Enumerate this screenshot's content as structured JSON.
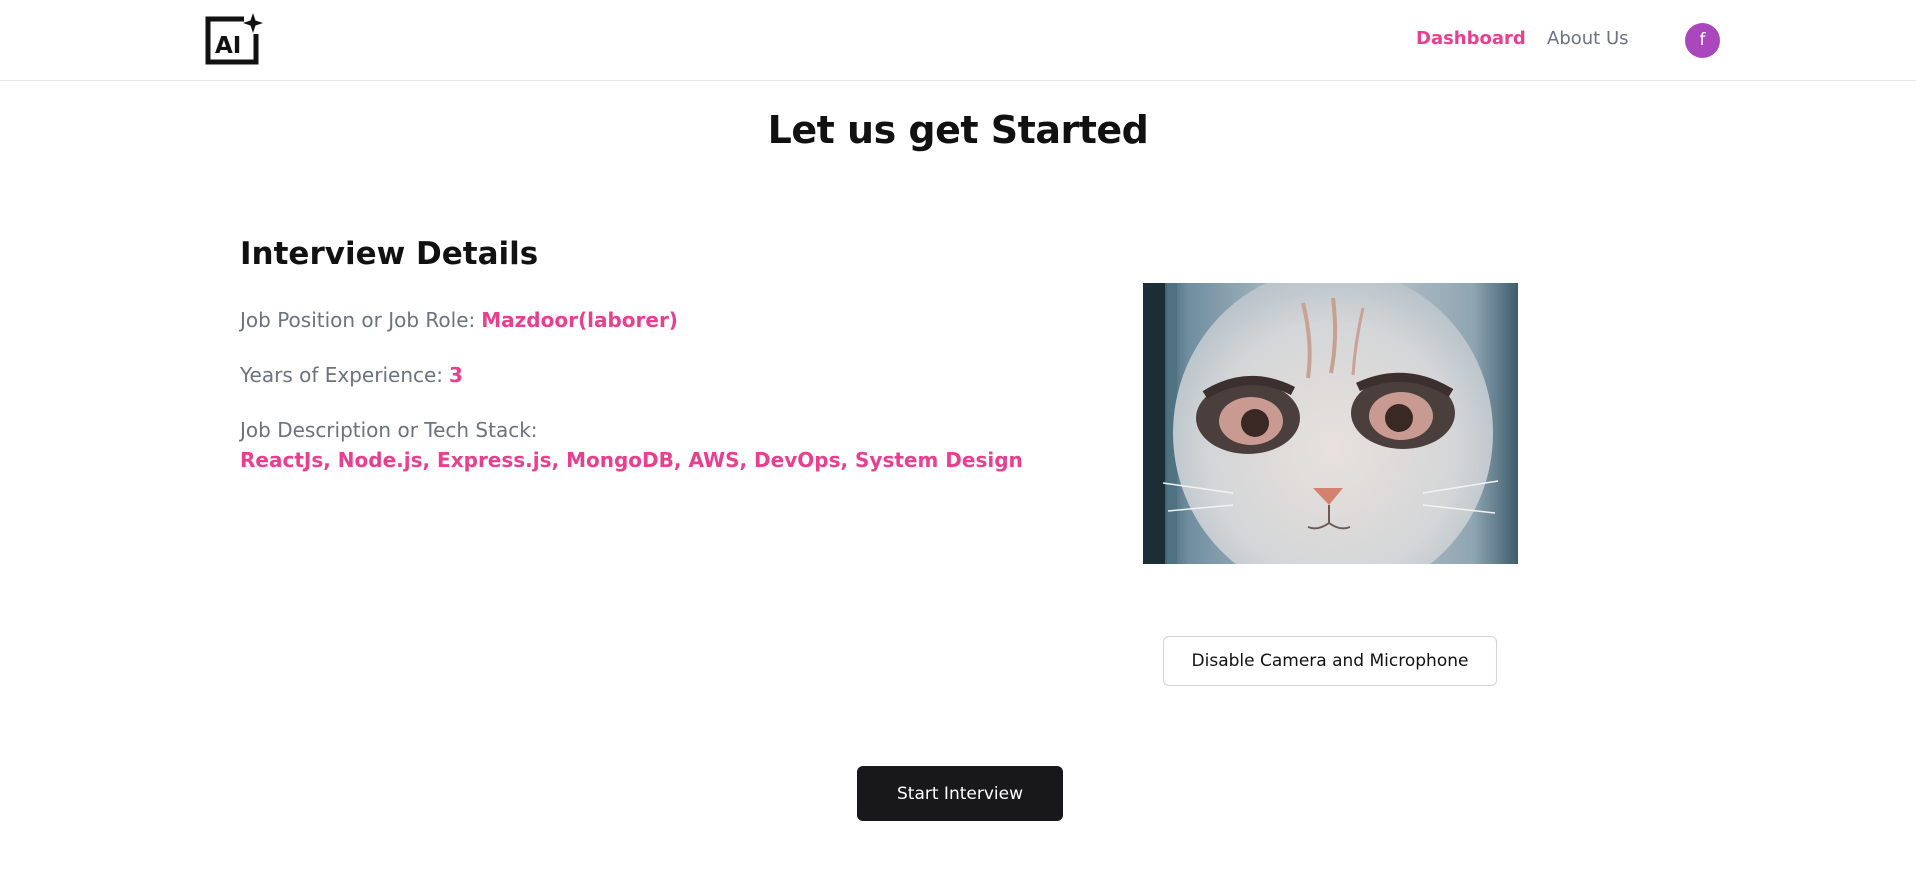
{
  "nav": {
    "logo_text": "AI",
    "links": [
      {
        "label": "Dashboard",
        "active": true
      },
      {
        "label": "About Us",
        "active": false
      }
    ],
    "avatar_initial": "f",
    "avatar_color": "#ab47bc"
  },
  "page": {
    "title": "Let us get Started"
  },
  "details": {
    "heading": "Interview Details",
    "job_role_label": "Job Position or Job Role:",
    "job_role_value": "Mazdoor(laborer)",
    "experience_label": "Years of Experience:",
    "experience_value": "3",
    "description_label": "Job Description or Tech Stack:",
    "description_value": "ReactJs, Node.js, Express.js, MongoDB, AWS, DevOps, System Design"
  },
  "camera": {
    "subject": "webcam-feed-cat-face"
  },
  "buttons": {
    "toggle_media_label": "Disable Camera and Microphone",
    "start_label": "Start Interview"
  },
  "colors": {
    "accent": "#e8408f",
    "muted_text": "#6b7280",
    "primary_button": "#18181b"
  }
}
